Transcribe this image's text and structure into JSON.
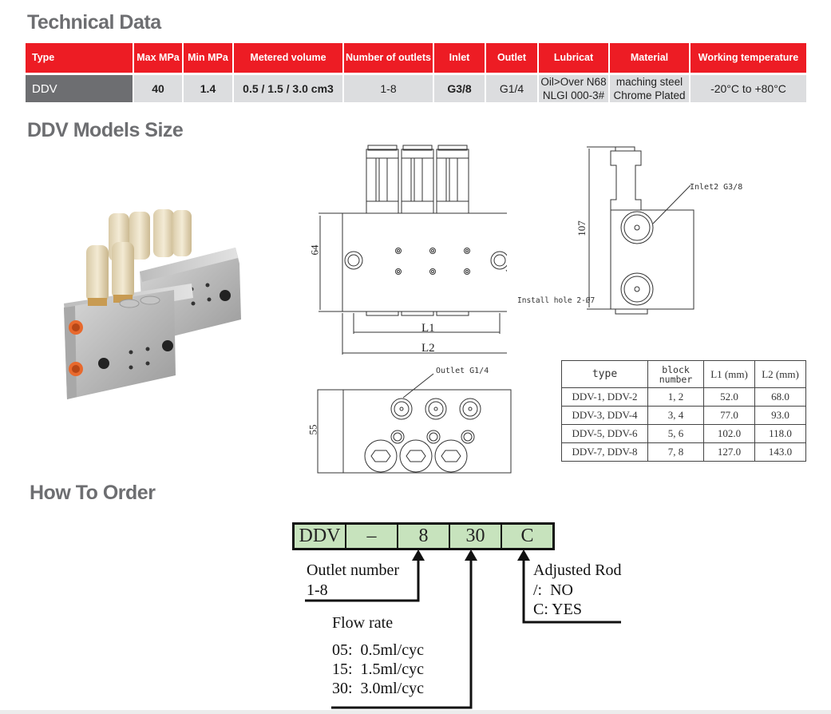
{
  "sections": {
    "technical_data": "Technical Data",
    "models_size": "DDV Models Size",
    "how_to_order": "How To Order"
  },
  "tech_table": {
    "headers": [
      "Type",
      "Max MPa",
      "Min MPa",
      "Metered volume",
      "Number of outlets",
      "Inlet",
      "Outlet",
      "Lubricat",
      "Material",
      "Working temperature"
    ],
    "row": {
      "type": "DDV",
      "max_mpa": "40",
      "min_mpa": "1.4",
      "metered_volume": "0.5 / 1.5 / 3.0 cm3",
      "outlets": "1-8",
      "inlet": "G3/8",
      "outlet": "G1/4",
      "lubricat_line1": "Oil>Over N68",
      "lubricat_line2": "NLGI 000-3#",
      "material_line1": "maching steel",
      "material_line2": "Chrome Plated",
      "temperature": "-20°C to +80°C"
    },
    "colors": {
      "header_bg": "#ed1c24",
      "type_cell_bg": "#6d6e71",
      "body_bg": "#dcdddf"
    }
  },
  "drawings": {
    "front_view": {
      "height_dim": "64",
      "l1": "L1",
      "l2": "L2",
      "install_hole": "Install hole 2-Ø7"
    },
    "side_view": {
      "height_dim": "107",
      "inlet": "Inlet2 G3/8"
    },
    "top_view": {
      "height_dim": "55",
      "outlet": "Outlet G1/4"
    }
  },
  "size_table": {
    "headers": [
      "type",
      "block number",
      "L1 (mm)",
      "L2 (mm)"
    ],
    "rows": [
      [
        "DDV-1, DDV-2",
        "1, 2",
        "52.0",
        "68.0"
      ],
      [
        "DDV-3, DDV-4",
        "3, 4",
        "77.0",
        "93.0"
      ],
      [
        "DDV-5, DDV-6",
        "5, 6",
        "102.0",
        "118.0"
      ],
      [
        "DDV-7, DDV-8",
        "7, 8",
        "127.0",
        "143.0"
      ]
    ]
  },
  "order": {
    "code": [
      "DDV",
      "–",
      "8",
      "30",
      "C"
    ],
    "outlet_number": {
      "title": "Outlet number",
      "value": "1-8"
    },
    "flow_rate": {
      "title": "Flow rate",
      "options": [
        "05:  0.5ml/cyc",
        "15:  1.5ml/cyc",
        "30:  3.0ml/cyc"
      ]
    },
    "adjusted_rod": {
      "title": "Adjusted Rod",
      "options": [
        "/:  NO",
        "C: YES"
      ]
    },
    "code_bg": "#c7e3bd"
  }
}
